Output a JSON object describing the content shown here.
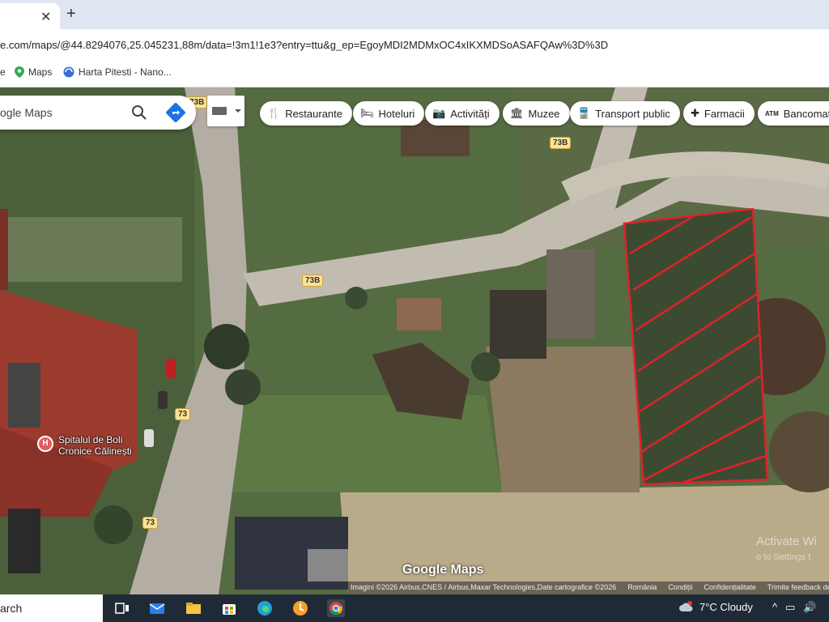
{
  "browser": {
    "tab_close": "✕",
    "new_tab": "+",
    "url": "e.com/maps/@44.8294076,25.045231,88m/data=!3m1!1e3?entry=ttu&g_ep=EgoyMDI2MDMxOC4xIKXMDSoASAFQAw%3D%3D",
    "bookmarks": [
      {
        "label": "e",
        "icon": "partial-icon"
      },
      {
        "label": "Maps",
        "icon": "maps-pin-icon"
      },
      {
        "label": "Harta Pitesti - Nano...",
        "icon": "bookmark-site-icon"
      }
    ]
  },
  "map": {
    "search_placeholder": "ogle Maps",
    "chips": [
      {
        "label": "Restaurante",
        "icon": "🍴"
      },
      {
        "label": "Hoteluri",
        "icon": "🛏"
      },
      {
        "label": "Activități",
        "icon": "📷"
      },
      {
        "label": "Muzee",
        "icon": "🏛"
      },
      {
        "label": "Transport public",
        "icon": "🚆"
      },
      {
        "label": "Farmacii",
        "icon": "✚"
      },
      {
        "label": "Bancomat",
        "icon": "ATM"
      }
    ],
    "route_labels": [
      "73B",
      "73B",
      "73B",
      "73",
      "73"
    ],
    "poi_icon": "H",
    "poi_name_line1": "Spitalul de Boli",
    "poi_name_line2": "Cronice Călinești",
    "logo": "Google Maps",
    "attribution": [
      "Imagini ©2026 Airbus,CNES / Airbus,Maxar Technologies,Date cartografice ©2026",
      "România",
      "Condiții",
      "Confidențialitate",
      "Trimite feedback des"
    ],
    "activate_line1": "Activate Wi",
    "activate_line2": "o to Settings t"
  },
  "taskbar": {
    "search_text": "arch",
    "weather": "7°C  Cloudy",
    "weather_icon": "cloud-icon",
    "tray": [
      "^",
      "▭",
      "🔊"
    ]
  },
  "colors": {
    "hatch_red": "#e0222a",
    "route_yellow": "#fde293",
    "taskbar": "#1f2a36"
  }
}
